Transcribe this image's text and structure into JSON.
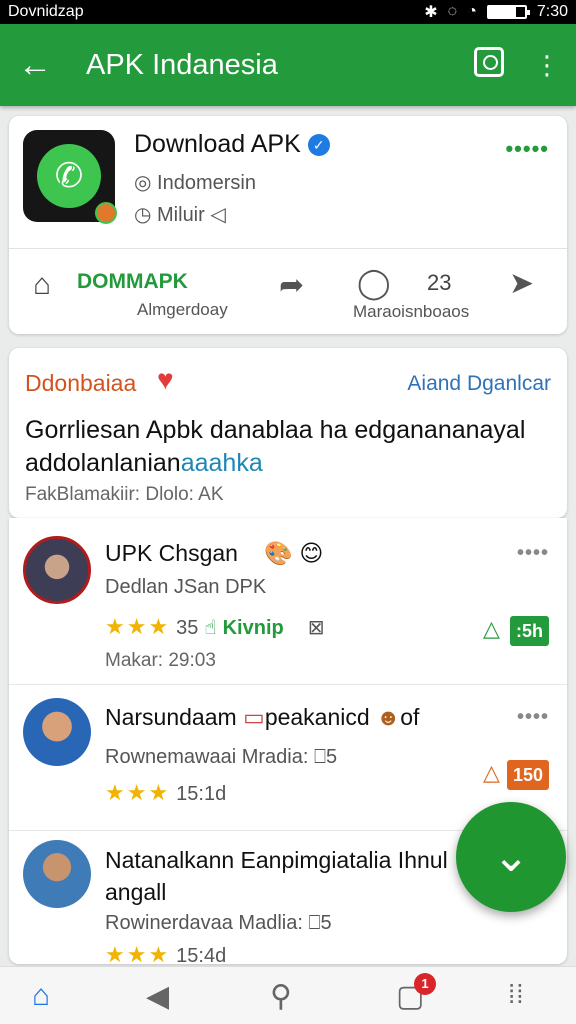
{
  "statusbar": {
    "left_text": "Dovnidzap",
    "time": "7:30",
    "battery_level": 0.75
  },
  "appbar": {
    "back_icon": "back-arrow-icon",
    "title": "APK Indanesia",
    "search_icon": "search-icon",
    "menu_icon": "more-vert-icon"
  },
  "profile": {
    "name": "Download APK",
    "verified": "✓",
    "meta1": "Indomersin",
    "meta2": "Miluir",
    "more": "•••••",
    "download_label": "DOMMAPK",
    "download_sub": "Almgerdoay",
    "comment_count": "23",
    "comment_sub": "Maraoisnboaos"
  },
  "post": {
    "author": "Ddonbaiaa",
    "follow_label": "Aiand Dganlcar",
    "body_text": "Gorrliesan Apbk danablaa ha edganananayal addolanlanian",
    "body_link": "aaahka",
    "footer": "FakBlamakiir: Dlolo: AK"
  },
  "comments": [
    {
      "name": "UPK Chsgan",
      "emoji": "🎨 😊",
      "sub": "Dedlan JSan DPK",
      "stars": "★★★",
      "count": "35",
      "extra": "Kivnip",
      "time": "Makar: 29:03",
      "tag": ":5h",
      "tag_color": "#239a3b"
    },
    {
      "name": "Narsundaam",
      "emoji": "peakanicd",
      "suffix": "of",
      "sub": "Rownemawaai Mradia:",
      "sub_count": "5",
      "stars": "★★★",
      "count": "15:1d",
      "tag": "150",
      "tag_color": "#e0651f"
    },
    {
      "name": "Natanalkann Eanpimgiatalia Ihnul angall",
      "sub": "Rowinerdavaa Madlia:",
      "sub_count": "5",
      "stars": "★★★",
      "count": "15:4d"
    }
  ],
  "nav": {
    "badge": "1"
  },
  "colors": {
    "primary": "#239a3b",
    "accent_blue": "#1a73e8",
    "badge_red": "#d9262a"
  }
}
